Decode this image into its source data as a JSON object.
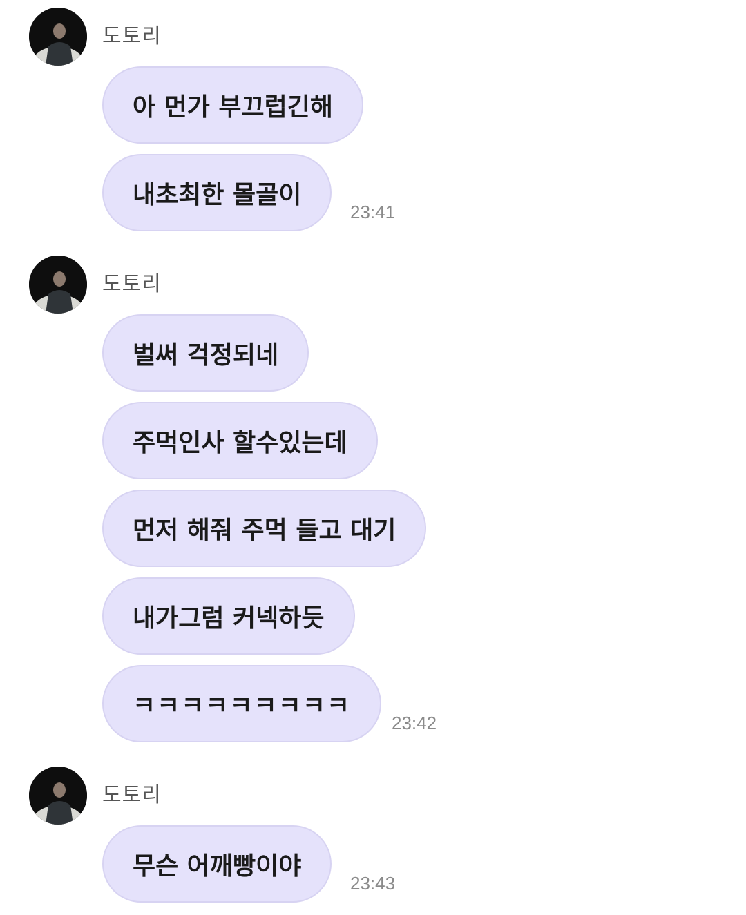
{
  "groups": [
    {
      "sender": "도토리",
      "messages": [
        "아 먼가 부끄럽긴해",
        "내초최한 몰골이"
      ],
      "time": "23:41"
    },
    {
      "sender": "도토리",
      "messages": [
        "벌써 걱정되네",
        "주먹인사 할수있는데",
        "먼저 해줘 주먹 들고 대기",
        "내가그럼 커넥하듯",
        "ㅋㅋㅋㅋㅋㅋㅋㅋㅋ"
      ],
      "time": "23:42"
    },
    {
      "sender": "도토리",
      "messages": [
        "무슨 어깨빵이야"
      ],
      "time": "23:43"
    }
  ],
  "colors": {
    "bubble": "#e5e2fb",
    "bubble_border": "#d7d3f2",
    "sender_text": "#555555",
    "time_text": "#8a8a8a"
  },
  "icons": {
    "avatar": "profile-photo"
  }
}
